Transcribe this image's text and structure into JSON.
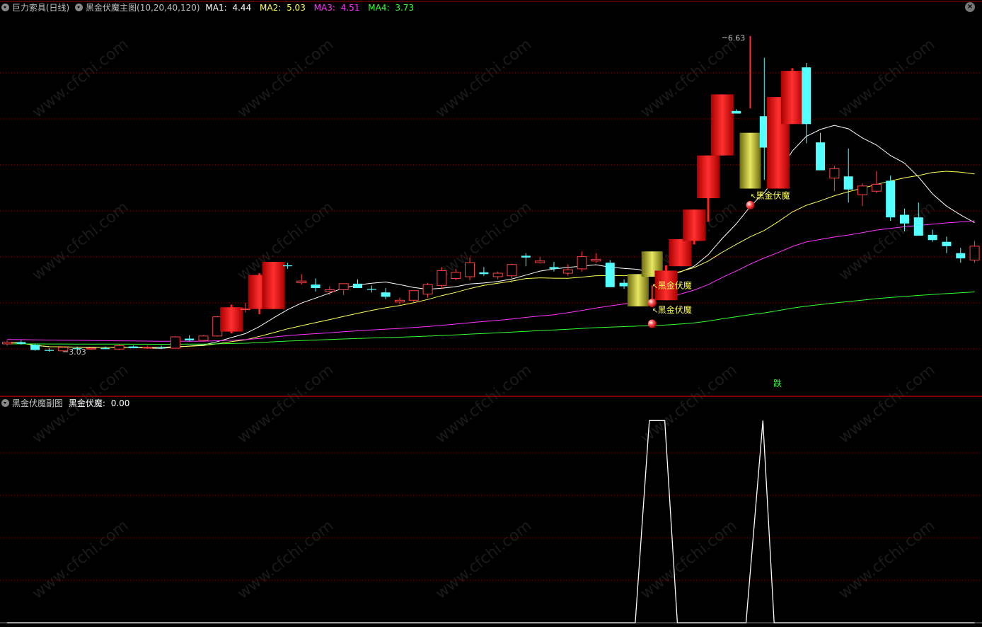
{
  "main_panel": {
    "name": "巨力索具",
    "period": "(日线)",
    "indicator_title": "黑金伏魔主图(10,20,40,120)",
    "ma_labels": [
      {
        "label": "MA1:",
        "value": "4.44",
        "color": "#ffffff"
      },
      {
        "label": "MA2:",
        "value": "5.03",
        "color": "#ffff55"
      },
      {
        "label": "MA3:",
        "value": "4.51",
        "color": "#ff33ff"
      },
      {
        "label": "MA4:",
        "value": "3.73",
        "color": "#33ff33"
      }
    ]
  },
  "sub_panel": {
    "indicator_title": "黑金伏魔副图",
    "value_label": "黑金伏魔:",
    "value": "0.00"
  },
  "watermark": "www.cfchi.com",
  "colors": {
    "up": "#ff4444",
    "down": "#54ffff",
    "ma1": "#ffffff",
    "ma2": "#ffff55",
    "ma3": "#ff33ff",
    "ma4": "#33ff33",
    "gold": "#b8b830",
    "grid": "#8b0000",
    "signal_line": "#ffffff"
  },
  "chart_data": {
    "type": "candlestick",
    "ylim": [
      2.6,
      6.9
    ],
    "x_count": 70,
    "candles": [
      [
        3.12,
        3.16,
        3.1,
        3.14
      ],
      [
        3.14,
        3.16,
        3.11,
        3.12
      ],
      [
        3.11,
        3.12,
        3.04,
        3.05
      ],
      [
        3.05,
        3.07,
        3.03,
        3.04
      ],
      [
        3.04,
        3.09,
        3.03,
        3.08
      ],
      [
        3.07,
        3.09,
        3.05,
        3.06
      ],
      [
        3.06,
        3.08,
        3.05,
        3.07
      ],
      [
        3.07,
        3.09,
        3.06,
        3.06
      ],
      [
        3.06,
        3.11,
        3.05,
        3.1
      ],
      [
        3.09,
        3.1,
        3.07,
        3.07
      ],
      [
        3.08,
        3.1,
        3.07,
        3.08
      ],
      [
        3.08,
        3.1,
        3.06,
        3.07
      ],
      [
        3.07,
        3.21,
        3.07,
        3.2
      ],
      [
        3.18,
        3.22,
        3.15,
        3.16
      ],
      [
        3.16,
        3.22,
        3.15,
        3.21
      ],
      [
        3.21,
        3.44,
        3.2,
        3.43
      ],
      [
        3.26,
        3.57,
        3.24,
        3.54
      ],
      [
        3.52,
        3.59,
        3.48,
        3.52
      ],
      [
        3.52,
        3.93,
        3.46,
        3.91
      ],
      [
        3.52,
        4.05,
        3.52,
        4.06
      ],
      [
        4.02,
        4.05,
        3.98,
        4.01
      ],
      [
        3.82,
        3.92,
        3.8,
        3.84
      ],
      [
        3.8,
        3.87,
        3.72,
        3.76
      ],
      [
        3.72,
        3.78,
        3.68,
        3.74
      ],
      [
        3.74,
        3.81,
        3.68,
        3.81
      ],
      [
        3.81,
        3.86,
        3.76,
        3.76
      ],
      [
        3.75,
        3.79,
        3.71,
        3.74
      ],
      [
        3.71,
        3.76,
        3.63,
        3.66
      ],
      [
        3.6,
        3.65,
        3.57,
        3.62
      ],
      [
        3.62,
        3.73,
        3.6,
        3.73
      ],
      [
        3.69,
        3.82,
        3.65,
        3.8
      ],
      [
        3.79,
        4.0,
        3.75,
        3.96
      ],
      [
        3.87,
        3.98,
        3.85,
        3.94
      ],
      [
        3.89,
        4.11,
        3.85,
        4.05
      ],
      [
        3.94,
        4.0,
        3.9,
        3.92
      ],
      [
        3.89,
        3.95,
        3.86,
        3.93
      ],
      [
        3.9,
        4.04,
        3.82,
        4.03
      ],
      [
        4.13,
        4.16,
        4.01,
        4.11
      ],
      [
        4.05,
        4.12,
        4.04,
        4.07
      ],
      [
        4.0,
        4.06,
        3.95,
        3.98
      ],
      [
        3.93,
        4.03,
        3.9,
        3.97
      ],
      [
        3.98,
        4.18,
        3.95,
        4.12
      ],
      [
        4.07,
        4.16,
        4.05,
        4.09
      ],
      [
        4.05,
        4.08,
        3.77,
        3.77
      ],
      [
        3.82,
        3.86,
        3.75,
        3.78
      ],
      [
        3.77,
        3.87,
        3.7,
        3.82
      ],
      [
        3.76,
        3.79,
        3.62,
        3.62
      ],
      [
        3.62,
        4.02,
        3.62,
        3.96
      ],
      [
        4.01,
        4.32,
        4.02,
        4.32
      ],
      [
        4.3,
        4.66,
        4.26,
        4.66
      ],
      [
        4.79,
        5.28,
        4.52,
        5.28
      ],
      [
        5.28,
        5.98,
        5.28,
        5.98
      ],
      [
        5.79,
        5.81,
        5.78,
        5.76
      ],
      [
        5.9,
        6.65,
        5.82,
        5.78
      ],
      [
        5.73,
        6.4,
        5.0,
        5.37
      ],
      [
        4.9,
        5.7,
        4.9,
        5.95
      ],
      [
        5.64,
        6.28,
        5.66,
        6.25
      ],
      [
        6.29,
        6.34,
        5.42,
        5.64
      ],
      [
        5.43,
        5.54,
        5.18,
        5.11
      ],
      [
        5.02,
        5.16,
        4.87,
        5.13
      ],
      [
        5.04,
        5.36,
        4.74,
        4.89
      ],
      [
        4.83,
        4.96,
        4.7,
        4.93
      ],
      [
        4.87,
        5.1,
        4.85,
        4.95
      ],
      [
        4.99,
        5.05,
        4.53,
        4.57
      ],
      [
        4.6,
        4.67,
        4.41,
        4.5
      ],
      [
        4.57,
        4.74,
        4.39,
        4.36
      ],
      [
        4.37,
        4.43,
        4.29,
        4.31
      ],
      [
        4.29,
        4.35,
        4.16,
        4.24
      ],
      [
        4.16,
        4.22,
        4.05,
        4.1
      ],
      [
        4.08,
        4.3,
        4.05,
        4.24
      ]
    ],
    "gold_bars": [
      [
        45,
        3.55,
        3.92
      ],
      [
        46,
        3.89,
        4.18
      ],
      [
        53,
        4.9,
        5.54
      ]
    ],
    "annotations": [
      {
        "text": "3.03",
        "candle": 4,
        "value": 3.03
      },
      {
        "text": "6.63",
        "candle": 51,
        "value": 6.63
      },
      {
        "text": "黑金伏魔",
        "candle": 46,
        "value": 3.51
      },
      {
        "text": "黑金伏魔",
        "candle": 46,
        "value": 3.79
      },
      {
        "text": "黑金伏魔",
        "candle": 53,
        "value": 4.82
      },
      {
        "text": "跌",
        "candle": 55,
        "value": 2.65
      }
    ],
    "signal_dots": [
      [
        46,
        3.35
      ],
      [
        46,
        3.59
      ],
      [
        53,
        4.71
      ]
    ],
    "sub_signal": {
      "ylim": [
        0,
        1.05
      ],
      "x": [
        0,
        44.8,
        45.8,
        46.9,
        47.8,
        52.7,
        53.9,
        54.7,
        69
      ],
      "y": [
        0,
        0,
        1,
        1,
        0,
        0,
        1,
        0,
        0
      ]
    }
  }
}
